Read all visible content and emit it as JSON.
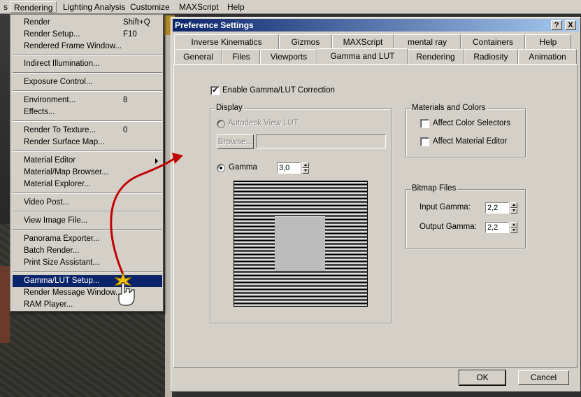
{
  "menubar": {
    "items": [
      {
        "label": "s"
      },
      {
        "label": "Rendering"
      },
      {
        "label": "Lighting Analysis"
      },
      {
        "label": "Customize"
      },
      {
        "label": "MAXScript"
      },
      {
        "label": "Help"
      }
    ]
  },
  "rendering_menu": {
    "items": [
      {
        "label": "Render",
        "shortcut": "Shift+Q"
      },
      {
        "label": "Render Setup...",
        "shortcut": "F10"
      },
      {
        "label": "Rendered Frame Window..."
      },
      {
        "label": "Indirect Illumination..."
      },
      {
        "label": "Exposure Control..."
      },
      {
        "label": "Environment...",
        "shortcut": "8"
      },
      {
        "label": "Effects..."
      },
      {
        "label": "Render To Texture...",
        "shortcut": "0"
      },
      {
        "label": "Render Surface Map..."
      },
      {
        "label": "Material Editor"
      },
      {
        "label": "Material/Map Browser..."
      },
      {
        "label": "Material Explorer..."
      },
      {
        "label": "Video Post..."
      },
      {
        "label": "View Image File..."
      },
      {
        "label": "Panorama Exporter..."
      },
      {
        "label": "Batch Render..."
      },
      {
        "label": "Print Size Assistant..."
      },
      {
        "label": "Gamma/LUT Setup..."
      },
      {
        "label": "Render Message Window..."
      },
      {
        "label": "RAM Player..."
      }
    ],
    "highlighted": "Gamma/LUT Setup..."
  },
  "dialog": {
    "title": "Preference Settings",
    "help_btn": "?",
    "close_btn": "X",
    "tabs_row1": [
      "Inverse Kinematics",
      "Gizmos",
      "MAXScript",
      "mental ray",
      "Containers",
      "Help"
    ],
    "tabs_row2": [
      "General",
      "Files",
      "Viewports",
      "Gamma and LUT",
      "Rendering",
      "Radiosity",
      "Animation"
    ],
    "active_tab": "Gamma and LUT",
    "enable_label": "Enable Gamma/LUT Correction",
    "enable_checked": true,
    "display": {
      "title": "Display",
      "autodesk_lut_label": "Autodesk View LUT",
      "browse_label": "Browse...",
      "browse_path": "",
      "gamma_label": "Gamma",
      "gamma_value": "3,0"
    },
    "materials": {
      "title": "Materials and Colors",
      "affect_color_selectors": "Affect Color Selectors",
      "affect_material_editor": "Affect Material Editor"
    },
    "bitmap": {
      "title": "Bitmap Files",
      "input_label": "Input Gamma:",
      "input_value": "2,2",
      "output_label": "Output Gamma:",
      "output_value": "2,2"
    },
    "ok_label": "OK",
    "cancel_label": "Cancel"
  },
  "colors": {
    "menu_highlight": "#0a246a",
    "title_bar_start": "#0a246a",
    "title_bar_end": "#a6caf0",
    "annotation_arrow": "#c00000"
  }
}
